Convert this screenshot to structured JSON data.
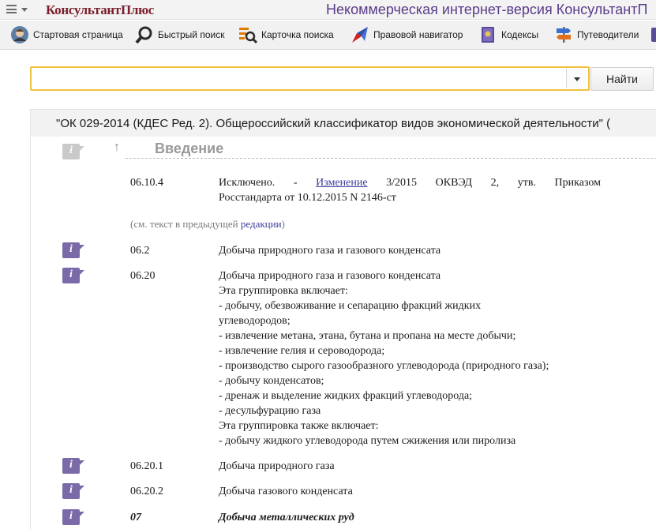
{
  "header": {
    "logo_text": "КонсультантПлюс",
    "site_title": "Некоммерческая интернет-версия КонсультантП"
  },
  "toolbar": {
    "items": [
      {
        "label": "Стартовая страница",
        "icon": "home-avatar-icon"
      },
      {
        "label": "Быстрый поиск",
        "icon": "magnifier-icon"
      },
      {
        "label": "Карточка поиска",
        "icon": "search-card-icon"
      },
      {
        "label": "Правовой навигатор",
        "icon": "navigator-compass-icon"
      },
      {
        "label": "Кодексы",
        "icon": "codex-book-icon"
      },
      {
        "label": "Путеводители",
        "icon": "guides-signpost-icon"
      }
    ]
  },
  "search": {
    "value": "",
    "button_label": "Найти"
  },
  "document": {
    "title": "\"ОК 029-2014 (КДЕС Ред. 2). Общероссийский классификатор видов экономической деятельности\" (",
    "section_heading": "Введение",
    "up_arrow": "↑",
    "badge_letter": "i",
    "excluded": {
      "code": "06.10.4",
      "text_before_link": "Исключено. - ",
      "link_text": "Изменение",
      "text_line1_rest": " 3/2015 ОКВЭД 2, утв. Приказом",
      "text_line2": "Росстандарта от 10.12.2015 N 2146-ст"
    },
    "prev_note": {
      "before": "(см. текст в предыдущей ",
      "link": "редакции",
      "after": ")"
    },
    "entries": [
      {
        "code": "06.2",
        "lines": [
          "Добыча природного газа и газового конденсата"
        ]
      },
      {
        "code": "06.20",
        "lines": [
          "Добыча природного газа и газового конденсата",
          "Эта группировка включает:",
          "- добычу, обезвоживание и сепарацию фракций жидких",
          "углеводородов;",
          "- извлечение метана, этана, бутана и пропана на месте добычи;",
          "- извлечение гелия и сероводорода;",
          "- производство сырого газообразного углеводорода (природного газа);",
          "- добычу конденсатов;",
          "- дренаж и выделение жидких фракций углеводорода;",
          "- десульфурацию газа",
          "Эта группировка также включает:",
          "- добычу жидкого углеводорода путем сжижения или пиролиза"
        ]
      },
      {
        "code": "06.20.1",
        "lines": [
          "Добыча природного газа"
        ]
      },
      {
        "code": "06.20.2",
        "lines": [
          "Добыча газового конденсата"
        ]
      },
      {
        "code": "07",
        "lines": [
          "Добыча металлических руд"
        ]
      }
    ]
  },
  "colors": {
    "logo": "#7b1f2c",
    "site_title": "#5a3d8a",
    "search_border": "#f0c040",
    "badge": "#7a6aa8",
    "link": "#3d3d9a"
  }
}
